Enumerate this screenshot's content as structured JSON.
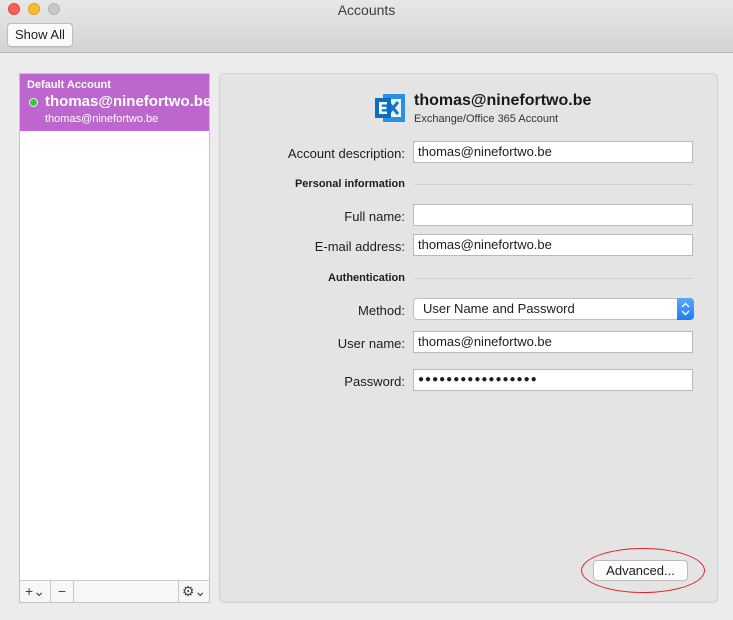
{
  "window": {
    "title": "Accounts",
    "show_all_label": "Show All"
  },
  "sidebar": {
    "accounts": [
      {
        "header": "Default Account",
        "name": "thomas@ninefortwo.be",
        "email": "thomas@ninefortwo.be",
        "status_color": "#32c93f"
      }
    ],
    "add_label": "+⌄",
    "remove_label": "−",
    "gear_label": "⚙⌄"
  },
  "panel": {
    "title": "thomas@ninefortwo.be",
    "subtitle": "Exchange/Office 365 Account",
    "account_description": {
      "label": "Account description:",
      "value": "thomas@ninefortwo.be"
    },
    "personal_section": "Personal information",
    "full_name": {
      "label": "Full name:",
      "value": ""
    },
    "email": {
      "label": "E-mail address:",
      "value": "thomas@ninefortwo.be"
    },
    "auth_section": "Authentication",
    "method": {
      "label": "Method:",
      "value": "User Name and Password"
    },
    "username": {
      "label": "User name:",
      "value": "thomas@ninefortwo.be"
    },
    "password": {
      "label": "Password:",
      "value": "●●●●●●●●●●●●●●●●●"
    },
    "advanced_label": "Advanced..."
  },
  "colors": {
    "selection": "#bd66cd",
    "highlight": "#e0201f",
    "exchange_blue": "#0a6ec8"
  }
}
